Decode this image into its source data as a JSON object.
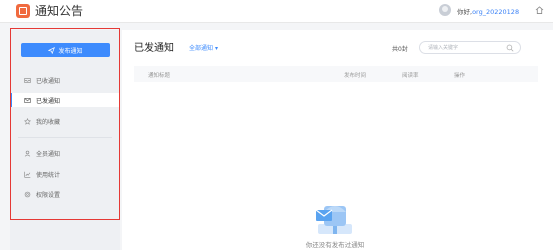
{
  "header": {
    "title": "通知公告",
    "greeting_prefix": "你好,",
    "username": "org_20220128"
  },
  "sidebar": {
    "publish_label": "发布通知",
    "items": [
      {
        "label": "已收通知",
        "icon": "inbox-icon",
        "active": false
      },
      {
        "label": "已发通知",
        "icon": "sent-icon",
        "active": true
      },
      {
        "label": "我的收藏",
        "icon": "star-icon",
        "active": false
      },
      {
        "label": "全员通知",
        "icon": "broadcast-icon",
        "active": false
      },
      {
        "label": "使用统计",
        "icon": "chart-icon",
        "active": false
      },
      {
        "label": "权限设置",
        "icon": "settings-icon",
        "active": false
      }
    ]
  },
  "main": {
    "title": "已发通知",
    "filter_label": "全部通知",
    "total_label": "共0封",
    "search_placeholder": "请输入关键字",
    "columns": [
      "通知标题",
      "发布时间",
      "阅读率",
      "操作"
    ],
    "rows": [],
    "empty_text": "你还没有发布过通知"
  },
  "colors": {
    "accent": "#3d8bfd",
    "logo": "#f06a3f",
    "highlight_box": "#e53935"
  }
}
